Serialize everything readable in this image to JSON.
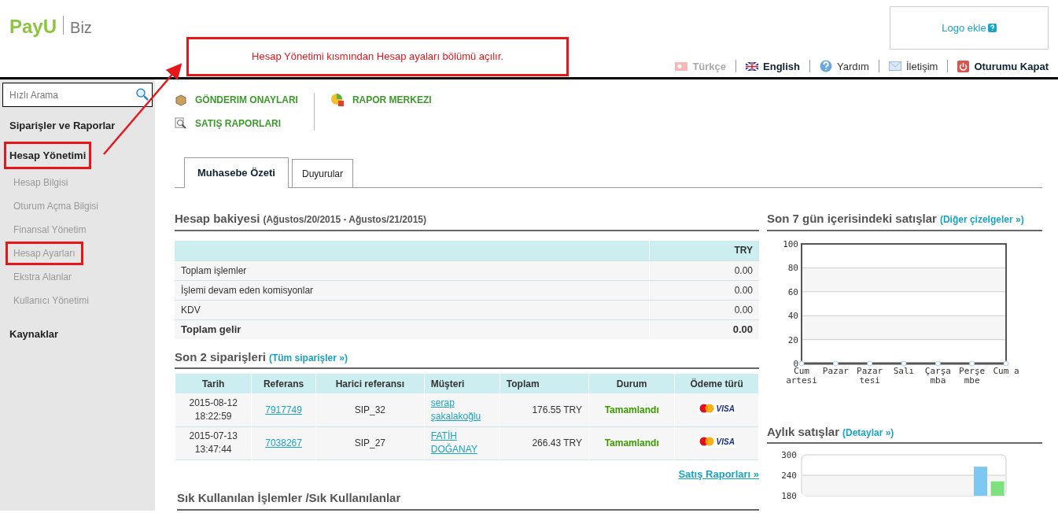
{
  "header": {
    "brand": "PayU",
    "product": "Biz",
    "logo_button": "Logo ekle",
    "languages": [
      {
        "label": "Türkçe",
        "selected": false
      },
      {
        "label": "English",
        "selected": true
      }
    ],
    "links": [
      {
        "label": "Yardım",
        "kind": "help"
      },
      {
        "label": "İletişim",
        "kind": "mail"
      },
      {
        "label": "Oturumu Kapat",
        "kind": "logout"
      }
    ]
  },
  "annotation": {
    "text": "Hesap Yönetimi kısmından Hesap ayaları bölümü açılır."
  },
  "sidebar": {
    "search": {
      "placeholder": "Hızlı Arama"
    },
    "items": [
      {
        "label": "Siparişler ve Raporlar",
        "kind": "section",
        "highlighted": false
      },
      {
        "label": "Hesap Yönetimi",
        "kind": "section",
        "highlighted": true
      },
      {
        "label": "Hesap Bilgisi",
        "kind": "sub",
        "highlighted": false
      },
      {
        "label": "Oturum Açma Bilgisi",
        "kind": "sub",
        "highlighted": false
      },
      {
        "label": "Finansal Yönetim",
        "kind": "sub",
        "highlighted": false
      },
      {
        "label": "Hesap Ayarları",
        "kind": "sub",
        "highlighted": true
      },
      {
        "label": "Ekstra Alanlar",
        "kind": "sub",
        "highlighted": false
      },
      {
        "label": "Kullanıcı Yönetimi",
        "kind": "sub",
        "highlighted": false
      },
      {
        "label": "Kaynaklar",
        "kind": "section",
        "highlighted": false
      }
    ]
  },
  "toolbar": [
    [
      {
        "label": "GÖNDERIM ONAYLARI",
        "kind": "package"
      },
      {
        "label": "SATIŞ RAPORLARI",
        "kind": "magnifier"
      }
    ],
    [
      {
        "label": "RAPOR MERKEZI",
        "kind": "report"
      }
    ]
  ],
  "tabs": [
    {
      "label": "Muhasebe Özeti",
      "selected": true
    },
    {
      "label": "Duyurular",
      "selected": false
    }
  ],
  "balance": {
    "title": "Hesap bakiyesi",
    "period": "(Ağustos/20/2015 - Ağustos/21/2015)",
    "currency": "TRY",
    "rows": [
      {
        "label": "Toplam işlemler",
        "value": "0.00",
        "kind": "normal"
      },
      {
        "label": "İşlemi devam eden komisyonlar",
        "value": "0.00",
        "kind": "normal"
      },
      {
        "label": "KDV",
        "value": "0.00",
        "kind": "normal"
      },
      {
        "label": "Toplam gelir",
        "value": "0.00",
        "kind": "total"
      }
    ]
  },
  "orders": {
    "title": "Son 2 siparişleri",
    "link": "(Tüm siparişler »)",
    "columns": [
      "Tarih",
      "Referans",
      "Harici referansı",
      "Müşteri",
      "Toplam",
      "Durum",
      "Ödeme türü"
    ],
    "rows": [
      {
        "date": "2015-08-12",
        "time": "18:22:59",
        "reference": "7917749",
        "external": "SIP_32",
        "customer": "serap şakalakoğlu",
        "total": "176.55 TRY",
        "status": "Tamamlandı",
        "payment": "VISA"
      },
      {
        "date": "2015-07-13",
        "time": "13:47:44",
        "reference": "7038267",
        "external": "SIP_27",
        "customer": "FATİH DOĞANAY",
        "total": "266.43 TRY",
        "status": "Tamamlandı",
        "payment": "VISA"
      }
    ],
    "more_link": "Satış Raporları »"
  },
  "frequent": {
    "title": "Sık Kullanılan İşlemler /Sık Kullanılanlar"
  },
  "weekly": {
    "title": "Son 7 gün içerisindeki satışlar",
    "link": "(Diğer çizelgeler »)",
    "chart_data": {
      "type": "line",
      "categories": [
        "Cum artesi",
        "Pazar",
        "Pazar tesi",
        "Salı",
        "Çarşa mba",
        "Perşe mbe",
        "Cum a"
      ],
      "series": [
        {
          "color": "#555555",
          "marker": "circle",
          "values": [
            0,
            0,
            0,
            0,
            0,
            0,
            0
          ]
        }
      ],
      "ylim": [
        0,
        100
      ],
      "yticks": [
        0,
        20,
        40,
        60,
        80,
        100
      ],
      "grid": true
    }
  },
  "monthly": {
    "title": "Aylık satışlar",
    "link": "(Detaylar »)",
    "chart_data": {
      "type": "bar",
      "ylim": [
        180,
        300
      ],
      "yticks": [
        180,
        240,
        300
      ],
      "grid": true,
      "series": [
        {
          "color": "#7cc8f0",
          "values": [
            null,
            null,
            null,
            null,
            null,
            null,
            null,
            null,
            null,
            null,
            265,
            null
          ]
        },
        {
          "color": "#7ee07e",
          "values": [
            null,
            null,
            null,
            null,
            null,
            null,
            null,
            null,
            null,
            null,
            null,
            222
          ]
        }
      ]
    }
  }
}
